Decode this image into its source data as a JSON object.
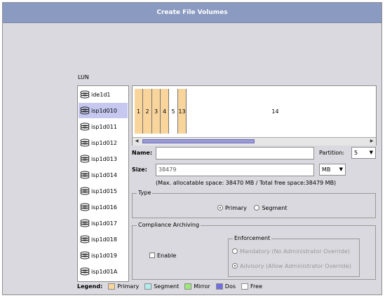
{
  "window": {
    "title": "Create File Volumes"
  },
  "lun": {
    "label": "LUN",
    "items": [
      {
        "name": "ide1d1",
        "selected": false
      },
      {
        "name": "isp1d010",
        "selected": true
      },
      {
        "name": "isp1d011",
        "selected": false
      },
      {
        "name": "isp1d012",
        "selected": false
      },
      {
        "name": "isp1d013",
        "selected": false
      },
      {
        "name": "isp1d014",
        "selected": false
      },
      {
        "name": "isp1d015",
        "selected": false
      },
      {
        "name": "isp1d016",
        "selected": false
      },
      {
        "name": "isp1d017",
        "selected": false
      },
      {
        "name": "isp1d018",
        "selected": false
      },
      {
        "name": "isp1d019",
        "selected": false
      },
      {
        "name": "isp1d01A",
        "selected": false
      }
    ]
  },
  "partitions": {
    "segments": [
      {
        "label": "1",
        "type": "primary"
      },
      {
        "label": "2",
        "type": "primary"
      },
      {
        "label": "3",
        "type": "primary"
      },
      {
        "label": "4",
        "type": "primary"
      },
      {
        "label": "5",
        "type": "free"
      },
      {
        "label": "13",
        "type": "primary"
      },
      {
        "label": "14",
        "type": "free"
      }
    ],
    "scroll_left_icon": "arrow-left-icon",
    "scroll_right_icon": "arrow-right-icon"
  },
  "form": {
    "name_label": "Name:",
    "name_value": "",
    "partition_label": "Partition:",
    "partition_value": "5",
    "size_label": "Size:",
    "size_value": "38479",
    "unit_value": "MB",
    "max_space_text": "(Max. allocatable space: 38470 MB / Total free space:38479 MB)"
  },
  "type_group": {
    "title": "Type",
    "primary_label": "Primary",
    "segment_label": "Segment",
    "selected": "Primary"
  },
  "compliance": {
    "title": "Compliance Archiving",
    "enable_label": "Enable",
    "enable_checked": false,
    "enforcement_title": "Enforcement",
    "mandatory_label": "Mandatory (No Administrator Override)",
    "advisory_label": "Advisory (Allow Administrator Override)",
    "selected": "Advisory"
  },
  "legend": {
    "label": "Legend:",
    "items": [
      {
        "label": "Primary",
        "color": "#f9d49b"
      },
      {
        "label": "Segment",
        "color": "#b2ecec"
      },
      {
        "label": "Mirror",
        "color": "#9ee87a"
      },
      {
        "label": "Dos",
        "color": "#6e6ee0"
      },
      {
        "label": "Free",
        "color": "#ffffff"
      }
    ]
  }
}
